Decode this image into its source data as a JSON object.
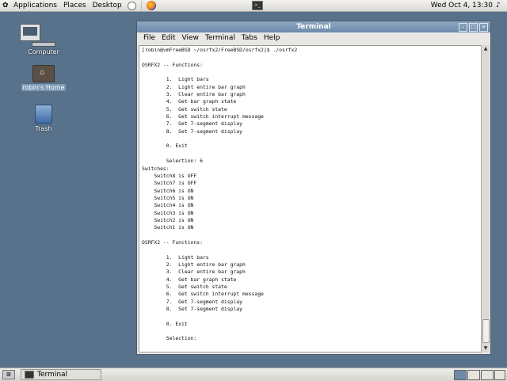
{
  "top_panel": {
    "menus": [
      "Applications",
      "Places",
      "Desktop"
    ],
    "clock": "Wed Oct  4, 13:30"
  },
  "desktop": {
    "icons": [
      {
        "label": "Computer"
      },
      {
        "label": "robin's Home"
      },
      {
        "label": "Trash"
      }
    ]
  },
  "window": {
    "title": "Terminal",
    "menus": [
      "File",
      "Edit",
      "View",
      "Terminal",
      "Tabs",
      "Help"
    ],
    "terminal_lines": [
      "[robin@vmFreeBSD ~/osrfx2/FreeBSD/osrfx2]$ ./osrfx2",
      "",
      "OSRFX2 -- Functions:",
      "",
      "        1.  Light bars",
      "        2.  Light entire bar graph",
      "        3.  Clear entire bar graph",
      "        4.  Get bar graph state",
      "        5.  Get switch state",
      "        6.  Get switch interrupt message",
      "        7.  Get 7-segment display",
      "        8.  Set 7-segment display",
      "",
      "        0. Exit",
      "",
      "        Selection: 6",
      "Switches:",
      "    Switch8 is OFF",
      "    Switch7 is OFF",
      "    Switch6 is ON",
      "    Switch5 is ON",
      "    Switch4 is ON",
      "    Switch3 is ON",
      "    Switch2 is ON",
      "    Switch1 is ON",
      "",
      "OSRFX2 -- Functions:",
      "",
      "        1.  Light bars",
      "        2.  Light entire bar graph",
      "        3.  Clear entire bar graph",
      "        4.  Get bar graph state",
      "        5.  Get switch state",
      "        6.  Get switch interrupt message",
      "        7.  Get 7-segment display",
      "        8.  Set 7-segment display",
      "",
      "        0. Exit",
      "",
      "        Selection:"
    ]
  },
  "taskbar": {
    "task_label": "Terminal"
  },
  "colors": {
    "desktop": "#58728c",
    "titlebar": "#6d8aab"
  }
}
